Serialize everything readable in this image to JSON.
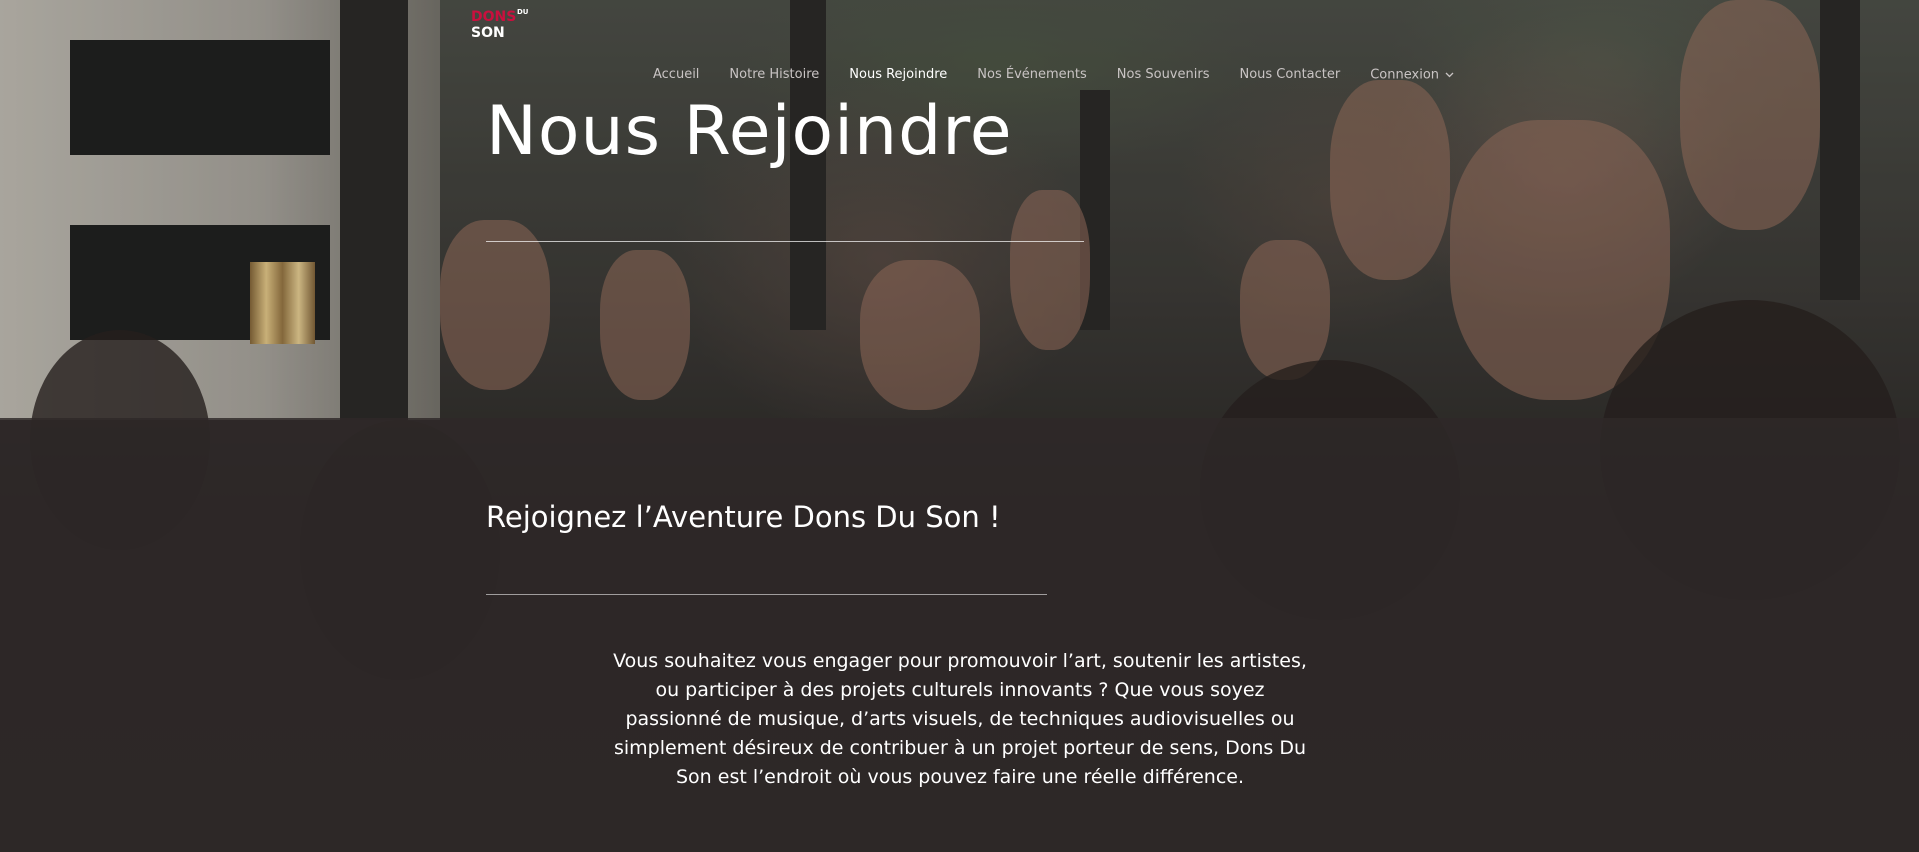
{
  "logo": {
    "line1": "DONS",
    "small": "DU",
    "line2": "SON"
  },
  "nav": {
    "items": [
      {
        "label": "Accueil",
        "active": false
      },
      {
        "label": "Notre Histoire",
        "active": false
      },
      {
        "label": "Nous Rejoindre",
        "active": true
      },
      {
        "label": "Nos Événements",
        "active": false
      },
      {
        "label": "Nos Souvenirs",
        "active": false
      },
      {
        "label": "Nous Contacter",
        "active": false
      },
      {
        "label": "Connexion",
        "active": false,
        "dropdown": true
      }
    ]
  },
  "hero": {
    "title": "Nous Rejoindre"
  },
  "section": {
    "title": "Rejoignez l’Aventure Dons Du Son !",
    "paragraph": "Vous souhaitez vous engager pour promouvoir l’art, soutenir les artistes, ou participer à des projets culturels innovants ? Que vous soyez passionné de musique, d’arts visuels, de techniques audiovisuelles ou simplement désireux de contribuer à un projet porteur de sens, Dons Du Son est l’endroit où vous pouvez faire une réelle différence."
  },
  "colors": {
    "brand": "#c8103e",
    "overlay": "#2d2828",
    "text": "#ffffff",
    "nav_inactive": "#c9c4c4"
  },
  "icons": {
    "dropdown": "chevron-down-icon"
  }
}
